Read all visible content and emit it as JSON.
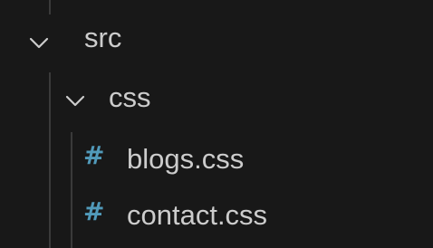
{
  "explorer": {
    "tree": [
      {
        "label": "src",
        "icon": "chevron-down-icon",
        "expanded": true
      },
      {
        "label": "css",
        "icon": "chevron-down-icon",
        "expanded": true
      },
      {
        "label": "blogs.css",
        "icon": "css-hash-icon",
        "icon_glyph": "#",
        "icon_color": "#519aba"
      },
      {
        "label": "contact.css",
        "icon": "css-hash-icon",
        "icon_glyph": "#",
        "icon_color": "#519aba"
      }
    ]
  },
  "colors": {
    "background": "#181818",
    "text": "#cccccc",
    "css_icon": "#519aba",
    "indent_guide": "#3a3a3a"
  }
}
